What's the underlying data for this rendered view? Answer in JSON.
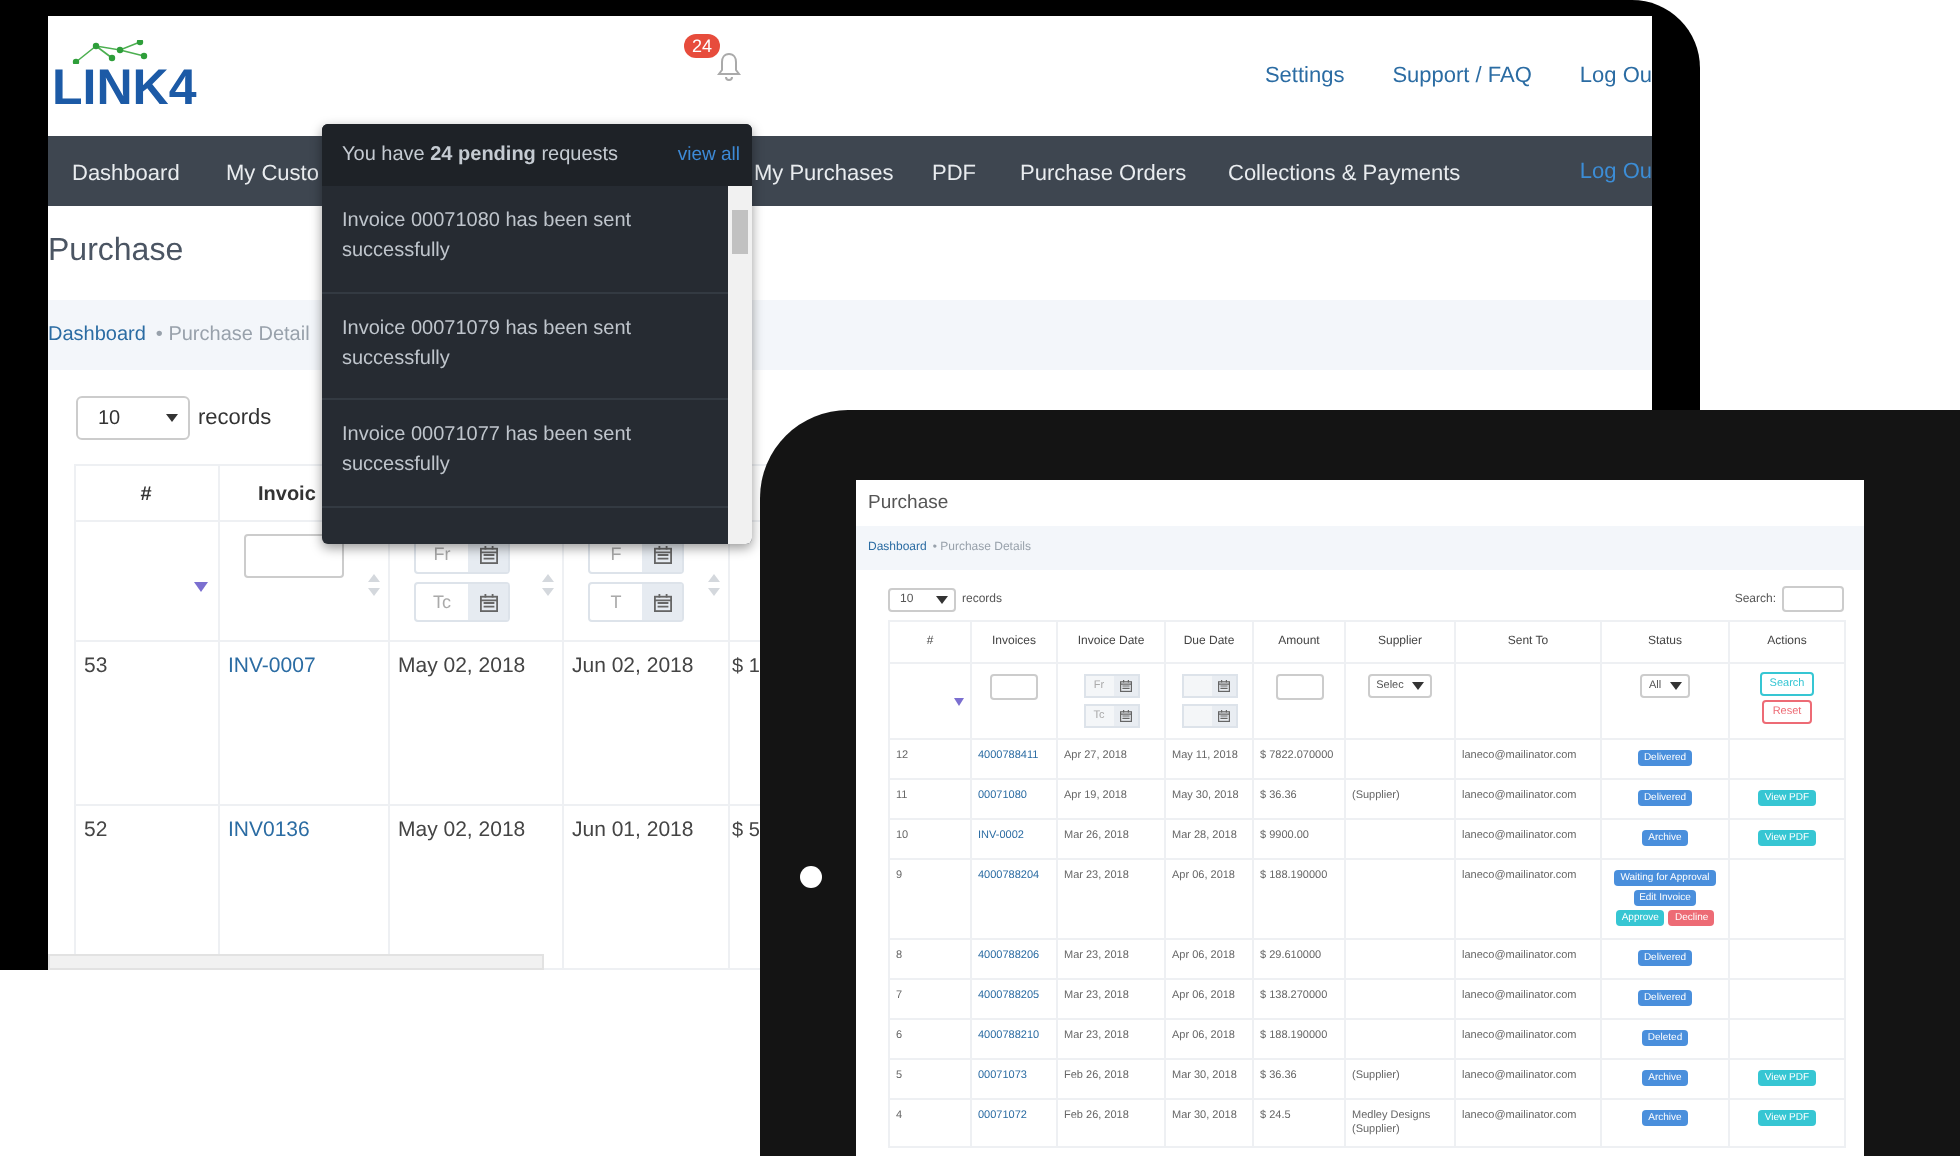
{
  "desktop": {
    "logo": "LINK4",
    "notification_count": "24",
    "header_links": [
      "Settings",
      "Support / FAQ",
      "Log Ou"
    ],
    "nav": [
      {
        "label": "Dashboard"
      },
      {
        "label": "My Custo"
      },
      {
        "label": "My Purchases"
      },
      {
        "label": "PDF"
      },
      {
        "label": "Purchase Orders"
      },
      {
        "label": "Collections & Payments"
      }
    ],
    "nav_logout": "Log Ou",
    "page_title": "Purchase",
    "breadcrumb": [
      "Dashboard",
      "• Purchase Detail"
    ],
    "page_size": "10",
    "page_size_label": "records",
    "table": {
      "columns": [
        "#",
        "Invoic"
      ],
      "filters": {
        "date_from": "Fr",
        "date_to": "Tc",
        "due_from": "F",
        "due_to": "T"
      },
      "rows": [
        {
          "number": "53",
          "invoice": "INV-0007",
          "invoice_date": "May 02, 2018",
          "due_date": "Jun 02, 2018",
          "amount": "$ 1"
        },
        {
          "number": "52",
          "invoice": "INV0136",
          "invoice_date": "May 02, 2018",
          "due_date": "Jun 01, 2018",
          "amount": "$ 5"
        }
      ]
    }
  },
  "dropdown": {
    "message": "You have **24 pending** requests",
    "link": "view all",
    "items": [
      "Invoice 00071080 has been sent successfully",
      "Invoice 00071079 has been sent successfully",
      "Invoice 00071077 has been sent successfully"
    ]
  },
  "tablet": {
    "page_title": "Purchase",
    "breadcrumb": [
      "Dashboard",
      "• Purchase Details"
    ],
    "page_size": "10",
    "page_size_label": "records",
    "search_label": "Search:",
    "columns": [
      "#",
      "Invoices",
      "Invoice Date",
      "Due Date",
      "Amount",
      "Supplier",
      "Sent To",
      "Status",
      "Actions"
    ],
    "filters": {
      "date_from": "Fr",
      "date_to": "Tc",
      "supplier": "Selec",
      "status": "All",
      "search_button": "Search",
      "reset_button": "Reset"
    },
    "rows": [
      {
        "number": "12",
        "invoice": "4000788411",
        "invoice_date": "Apr 27, 2018",
        "due_date": "May 11, 2018",
        "amount": "$ 7822.070000",
        "supplier": "",
        "sent_to": "laneco@mailinator.com",
        "status": [
          {
            "label": "Delivered",
            "kind": "info"
          }
        ],
        "actions": []
      },
      {
        "number": "11",
        "invoice": "00071080",
        "invoice_date": "Apr 19, 2018",
        "due_date": "May 30, 2018",
        "amount": "$ 36.36",
        "supplier": "(Supplier)",
        "sent_to": "laneco@mailinator.com",
        "status": [
          {
            "label": "Delivered",
            "kind": "info"
          }
        ],
        "actions": [
          "View PDF"
        ]
      },
      {
        "number": "10",
        "invoice": "INV-0002",
        "invoice_date": "Mar 26, 2018",
        "due_date": "Mar 28, 2018",
        "amount": "$ 9900.00",
        "supplier": "",
        "sent_to": "laneco@mailinator.com",
        "status": [
          {
            "label": "Archive",
            "kind": "info"
          }
        ],
        "actions": [
          "View PDF"
        ]
      },
      {
        "number": "9",
        "invoice": "4000788204",
        "invoice_date": "Mar 23, 2018",
        "due_date": "Apr 06, 2018",
        "amount": "$ 188.190000",
        "supplier": "",
        "sent_to": "laneco@mailinator.com",
        "status": [
          {
            "label": "Waiting for Approval",
            "kind": "info"
          },
          {
            "label": "Edit Invoice",
            "kind": "info"
          },
          {
            "label": "Approve",
            "kind": "approve"
          },
          {
            "label": "Decline",
            "kind": "decline"
          }
        ],
        "actions": []
      },
      {
        "number": "8",
        "invoice": "4000788206",
        "invoice_date": "Mar 23, 2018",
        "due_date": "Apr 06, 2018",
        "amount": "$ 29.610000",
        "supplier": "",
        "sent_to": "laneco@mailinator.com",
        "status": [
          {
            "label": "Delivered",
            "kind": "info"
          }
        ],
        "actions": []
      },
      {
        "number": "7",
        "invoice": "4000788205",
        "invoice_date": "Mar 23, 2018",
        "due_date": "Apr 06, 2018",
        "amount": "$ 138.270000",
        "supplier": "",
        "sent_to": "laneco@mailinator.com",
        "status": [
          {
            "label": "Delivered",
            "kind": "info"
          }
        ],
        "actions": []
      },
      {
        "number": "6",
        "invoice": "4000788210",
        "invoice_date": "Mar 23, 2018",
        "due_date": "Apr 06, 2018",
        "amount": "$ 188.190000",
        "supplier": "",
        "sent_to": "laneco@mailinator.com",
        "status": [
          {
            "label": "Deleted",
            "kind": "info"
          }
        ],
        "actions": []
      },
      {
        "number": "5",
        "invoice": "00071073",
        "invoice_date": "Feb 26, 2018",
        "due_date": "Mar 30, 2018",
        "amount": "$ 36.36",
        "supplier": "(Supplier)",
        "sent_to": "laneco@mailinator.com",
        "status": [
          {
            "label": "Archive",
            "kind": "info"
          }
        ],
        "actions": [
          "View PDF"
        ]
      },
      {
        "number": "4",
        "invoice": "00071072",
        "invoice_date": "Feb 26, 2018",
        "due_date": "Mar 30, 2018",
        "amount": "$ 24.5",
        "supplier": "Medley Designs (Supplier)",
        "sent_to": "laneco@mailinator.com",
        "status": [
          {
            "label": "Archive",
            "kind": "info"
          }
        ],
        "actions": [
          "View PDF"
        ]
      }
    ]
  }
}
